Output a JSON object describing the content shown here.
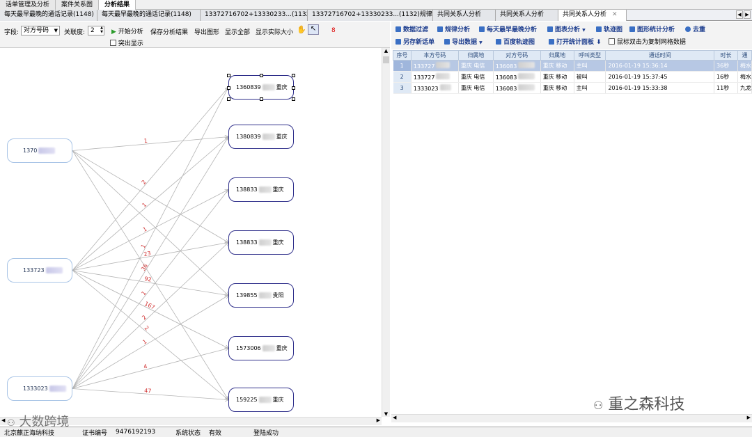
{
  "top_tabs": [
    "话单管理及分析",
    "案件关系图",
    "分析结果"
  ],
  "sub_tabs": [
    "每天最早最晚的通话记录(1148)",
    "每天最早最晚的通话记录(1148)",
    "13372716702+13330233...(1132)",
    "13372716702+13330233...(1132)规律分析",
    "共同关系人分析",
    "共同关系人分析",
    "共同关系人分析"
  ],
  "sub_tab_close": "✕",
  "left_toolbar": {
    "field_label": "字段:",
    "field_value": "对方号码",
    "degree_label": "关联度:",
    "degree_value": "2",
    "start_btn": "开始分析",
    "save_btn": "保存分析结果",
    "export_btn": "导出图形",
    "show_all_btn": "显示全部",
    "actual_size_btn": "显示实际大小",
    "count_text": "8",
    "highlight_label": "突出显示"
  },
  "graph": {
    "source_nodes": [
      {
        "prefix": "1370",
        "suffix": ""
      },
      {
        "prefix": "133723",
        "suffix": ""
      },
      {
        "prefix": "1333023",
        "suffix": ""
      }
    ],
    "target_nodes": [
      {
        "prefix": "1360839",
        "city": "重庆"
      },
      {
        "prefix": "1380839",
        "city": "重庆"
      },
      {
        "prefix": "138833",
        "city": "重庆"
      },
      {
        "prefix": "138833",
        "city": "重庆"
      },
      {
        "prefix": "139855",
        "city": "贵阳"
      },
      {
        "prefix": "1573006",
        "city": "重庆"
      },
      {
        "prefix": "159225",
        "city": "重庆"
      }
    ],
    "edges": [
      {
        "from": 0,
        "to": 1,
        "label": "1"
      },
      {
        "from": 0,
        "to": 3,
        "label": ""
      },
      {
        "from": 0,
        "to": 4,
        "label": ""
      },
      {
        "from": 0,
        "to": 6,
        "label": ""
      },
      {
        "from": 1,
        "to": 0,
        "label": "2"
      },
      {
        "from": 1,
        "to": 1,
        "label": "1"
      },
      {
        "from": 1,
        "to": 2,
        "label": "1"
      },
      {
        "from": 1,
        "to": 3,
        "label": "23"
      },
      {
        "from": 1,
        "to": 4,
        "label": "92"
      },
      {
        "from": 1,
        "to": 5,
        "label": "167"
      },
      {
        "from": 1,
        "to": 6,
        "label": "2"
      },
      {
        "from": 2,
        "to": 0,
        "label": "1"
      },
      {
        "from": 2,
        "to": 1,
        "label": "36"
      },
      {
        "from": 2,
        "to": 2,
        "label": "1"
      },
      {
        "from": 2,
        "to": 3,
        "label": "2"
      },
      {
        "from": 2,
        "to": 4,
        "label": "1"
      },
      {
        "from": 2,
        "to": 5,
        "label": "4"
      },
      {
        "from": 2,
        "to": 6,
        "label": "47"
      }
    ]
  },
  "right_toolbar": {
    "row1": [
      "数据过滤",
      "规律分析",
      "每天最早最晚分析",
      "图表分析",
      "轨迹图",
      "图形统计分析",
      "去重"
    ],
    "row2": [
      "另存新话单",
      "导出数据",
      "百度轨迹图",
      "打开统计面板"
    ],
    "copy_checkbox": "鼠标双击为复制网格数据"
  },
  "table": {
    "columns": [
      "序号",
      "本方号码",
      "归属地",
      "对方号码",
      "归属地",
      "呼叫类型",
      "通话时间",
      "时长",
      "通"
    ],
    "rows": [
      [
        "1",
        "133727",
        "重庆 电信",
        "136083",
        "重庆 移动",
        "主叫",
        "2016-01-19 15:36:14",
        "36秒",
        "梅水"
      ],
      [
        "2",
        "133727",
        "重庆 电信",
        "136083",
        "重庆 移动",
        "被叫",
        "2016-01-19 15:37:45",
        "16秒",
        "梅水"
      ],
      [
        "3",
        "1333023",
        "重庆 电信",
        "136083",
        "重庆 移动",
        "主叫",
        "2016-01-19 15:33:38",
        "11秒",
        "九龙"
      ]
    ]
  },
  "status": {
    "company": "北京麒正海纳科技",
    "cert_label": "证书编号",
    "cert_value": "9476192193",
    "sys_label": "系统状态",
    "sys_value": "有效",
    "login": "登陆成功"
  },
  "watermarks": {
    "left": "大数跨境",
    "right": "重之森科技"
  }
}
